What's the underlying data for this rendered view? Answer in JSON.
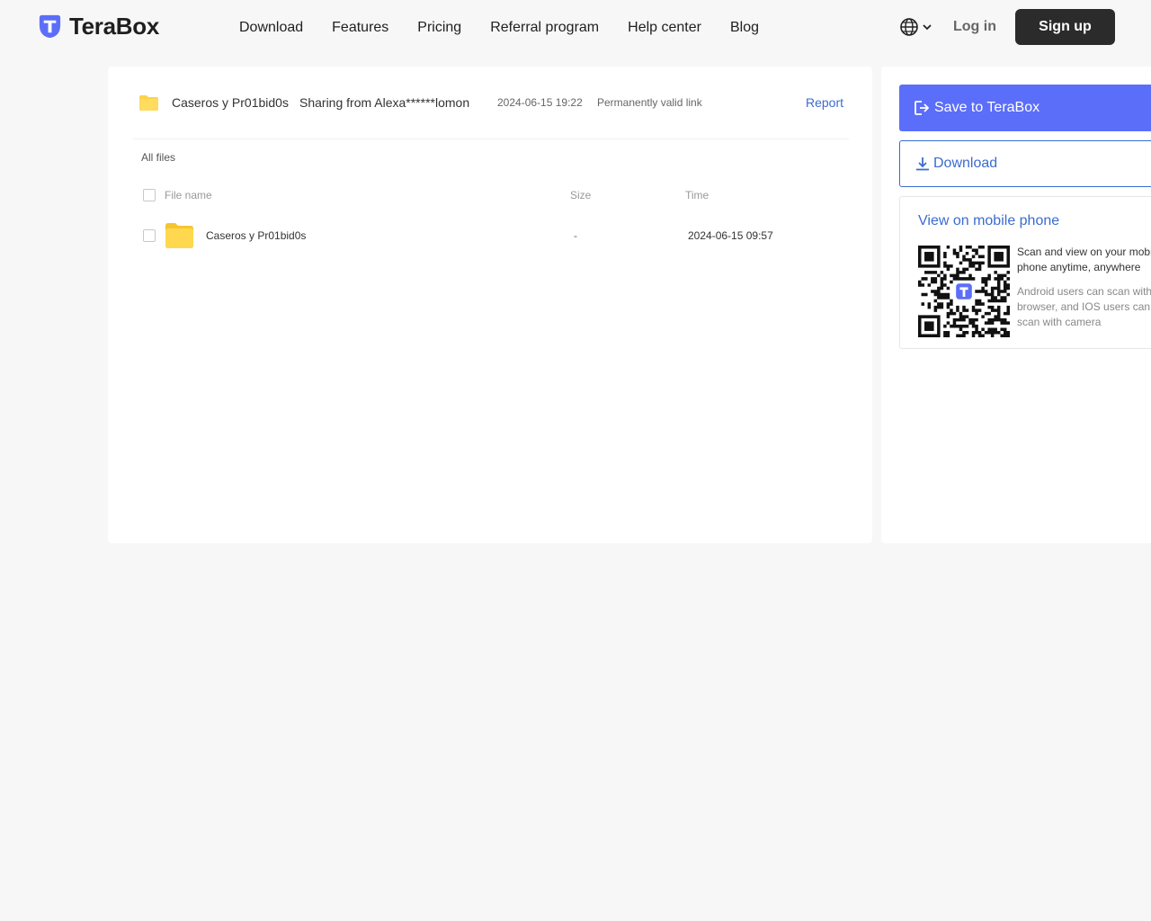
{
  "header": {
    "brand": "TeraBox",
    "nav": [
      "Download",
      "Features",
      "Pricing",
      "Referral program",
      "Help center",
      "Blog"
    ],
    "login": "Log in",
    "signup": "Sign up"
  },
  "share": {
    "title": "Caseros y Pr01bid0s",
    "sharing_from": "Sharing from Alexa******lomon",
    "date": "2024-06-15 19:22",
    "validity": "Permanently valid link",
    "report": "Report"
  },
  "files": {
    "breadcrumb": "All files",
    "columns": {
      "name": "File name",
      "size": "Size",
      "time": "Time"
    },
    "rows": [
      {
        "name": "Caseros y Pr01bid0s",
        "size": "-",
        "time": "2024-06-15 09:57"
      }
    ]
  },
  "side": {
    "save_label": "Save to TeraBox",
    "download_label": "Download",
    "mobile_title": "View on mobile phone",
    "scan_main_1": "Scan and view on your mobi",
    "scan_main_2": "phone anytime, anywhere",
    "scan_sub_1": "Android users can scan with",
    "scan_sub_2": "browser, and IOS users can",
    "scan_sub_3": "scan with camera"
  },
  "colors": {
    "brand": "#5b6ef9",
    "link": "#3b6ccf",
    "folder": "#ffd24a",
    "signup_bg": "#2b2b2b"
  }
}
